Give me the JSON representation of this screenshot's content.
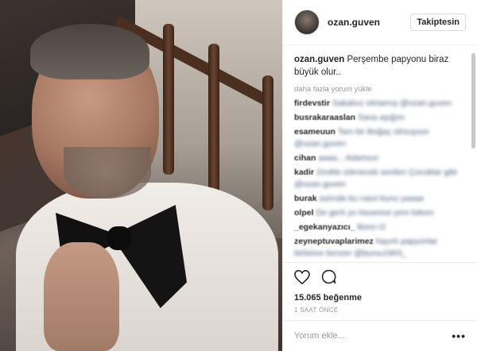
{
  "post": {
    "username": "ozan.guven",
    "follow_label": "Takiptesin",
    "caption_user": "ozan.guven",
    "caption_text": "Perşembe papyonu biraz büyük olur..",
    "load_more": "daha fazla yorum yükle",
    "comments": [
      {
        "user": "firdevstir",
        "text": "Sakalsız olmamış @ozan.guven"
      },
      {
        "user": "busrakaraaslan",
        "text": "Sana aşığım"
      },
      {
        "user": "esameuun",
        "text": "Tam bir Boğaç olmuşsun @ozan.guven"
      },
      {
        "user": "cihan",
        "text": "aaaa... Adamsın"
      },
      {
        "user": "kadir",
        "text": "Zevkle izlenecek sevilen Çocuklar gibi @ozan.guven"
      },
      {
        "user": "burak",
        "text": "aslında bu nasıl bunu yaaaa"
      },
      {
        "user": "olpel",
        "text": "De gerti yo hissemsi yeni lottom"
      },
      {
        "user": "_egekanyazıcı_",
        "text": "Bonn O"
      },
      {
        "user": "zeyneptuvaplarimez",
        "text": "hayırlı papyonlar birbirine benzer @bursu1903_"
      }
    ],
    "likes": "15.065 beğenme",
    "time": "1 SAAT ÖNCE",
    "comment_placeholder": "Yorum ekle...",
    "more_label": "•••"
  }
}
